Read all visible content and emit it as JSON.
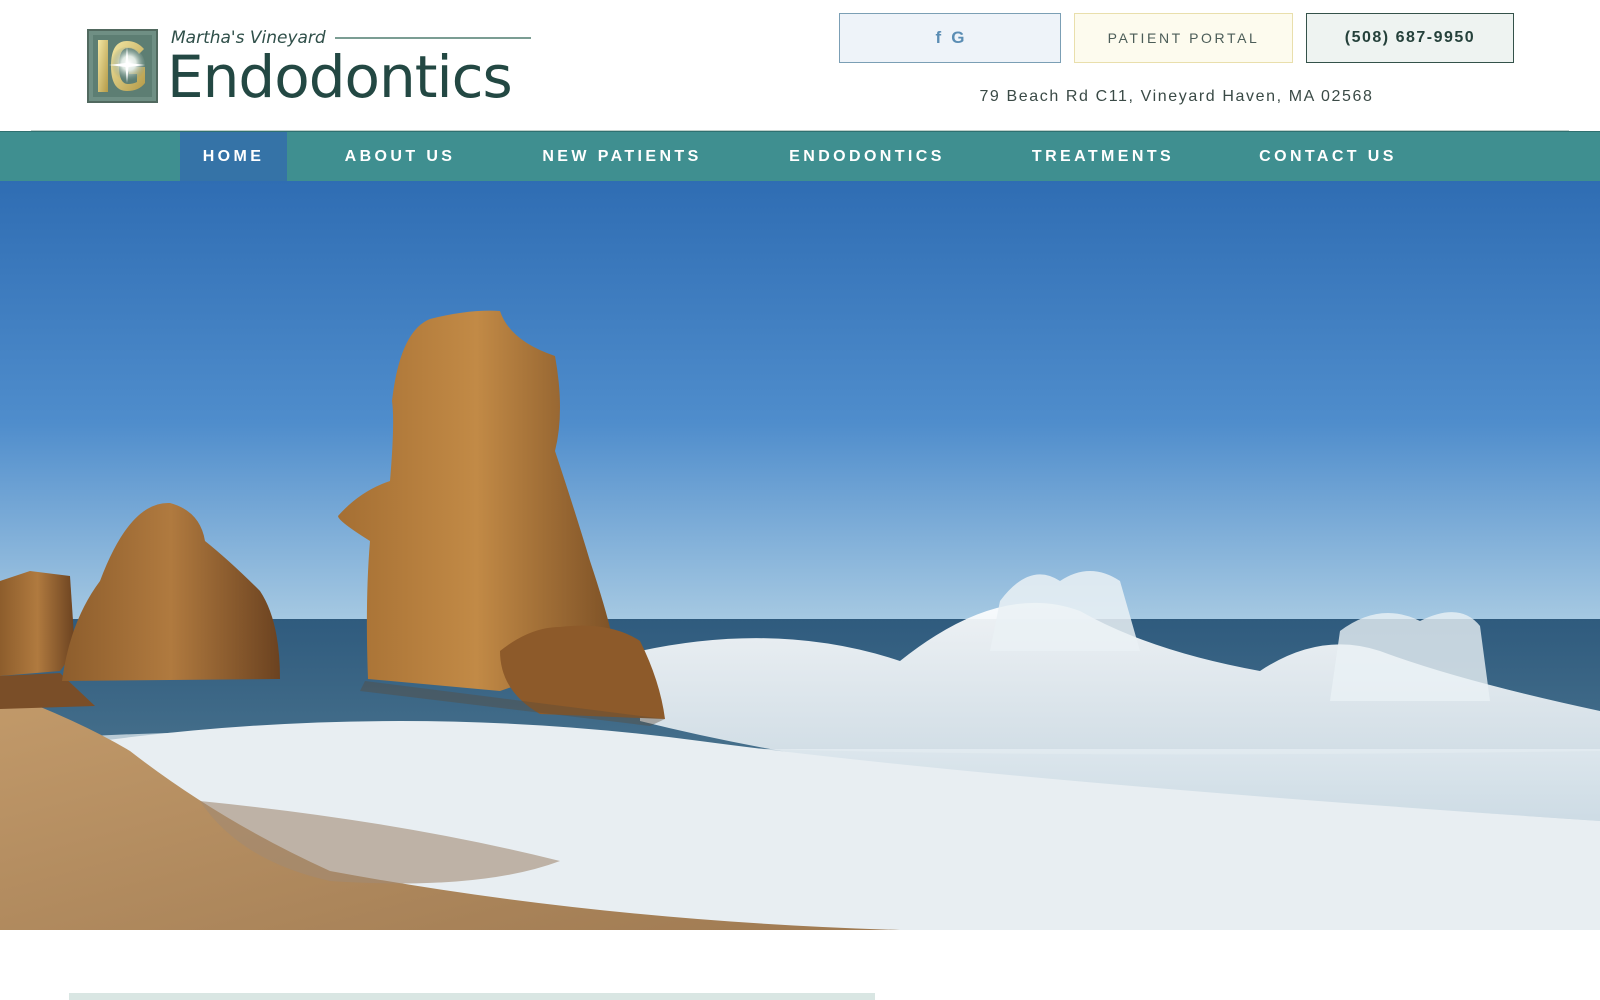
{
  "brand": {
    "tagline": "Martha's Vineyard",
    "name": "Endodontics",
    "logo_icon": "ig-monogram-logo-icon",
    "colors": {
      "primary_green": "#234843",
      "nav_teal": "#3f8f90",
      "nav_active": "#3573a7"
    }
  },
  "header": {
    "social_icons": [
      {
        "name": "facebook-icon",
        "glyph": "f"
      },
      {
        "name": "google-icon",
        "glyph": "G"
      }
    ],
    "patient_portal_label": "PATIENT PORTAL",
    "phone_label": "(508) 687-9950",
    "address": "79 Beach Rd C11, Vineyard Haven, MA 02568"
  },
  "nav": {
    "items": [
      {
        "label": "HOME",
        "active": true
      },
      {
        "label": "ABOUT US",
        "active": false
      },
      {
        "label": "NEW PATIENTS",
        "active": false
      },
      {
        "label": "ENDODONTICS",
        "active": false
      },
      {
        "label": "TREATMENTS",
        "active": false
      },
      {
        "label": "CONTACT US",
        "active": false
      }
    ]
  },
  "hero": {
    "image_subject": "beach-rocks-ocean-waves"
  }
}
